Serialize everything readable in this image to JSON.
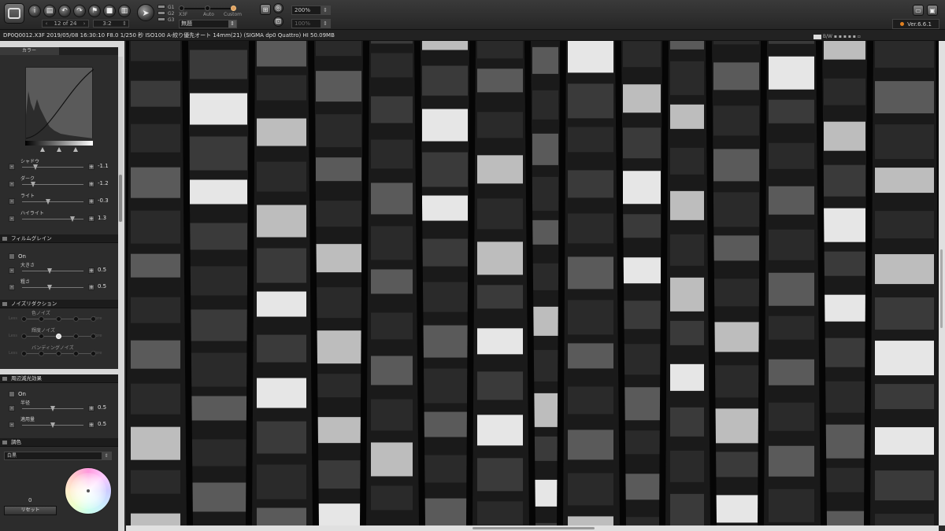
{
  "toolbar": {
    "frame_nav": "12 of 24",
    "aspect": "3:2",
    "mode_select": "無題",
    "track_labels": [
      "X3F",
      "Auto",
      "Custom"
    ],
    "g_labels": [
      "G1",
      "G2",
      "G3"
    ],
    "zoom": "200%",
    "zoom2": "100%",
    "version": "Ver.6.6.1"
  },
  "info": {
    "text": "DP0Q0012.X3F 2019/05/08 16:30:10 F8.0 1/250 秒 ISO100 A-絞り優先オート 14mm(21) (SIGMA dp0 Quattro) HI 50.09MB",
    "bw": "B/W"
  },
  "color_section": {
    "tab": "カラー",
    "sliders": [
      {
        "label": "シャドウ",
        "value": "-1.1",
        "level": 0.22
      },
      {
        "label": "ダーク",
        "value": "-1.2",
        "level": 0.18
      },
      {
        "label": "ライト",
        "value": "-0.3",
        "level": 0.42
      },
      {
        "label": "ハイライト",
        "value": "1.3",
        "level": 0.82
      }
    ]
  },
  "film_grain": {
    "title": "フィルムグレイン",
    "on_label": "On",
    "sliders": [
      {
        "label": "大きさ",
        "value": "0.5",
        "level": 0.45
      },
      {
        "label": "粗さ",
        "value": "0.5",
        "level": 0.45
      }
    ]
  },
  "noise": {
    "title": "ノイズリダクション",
    "rows": [
      {
        "label": "色ノイズ",
        "less": "Less",
        "more": "More",
        "selected": -1
      },
      {
        "label": "輝度ノイズ",
        "less": "Less",
        "more": "More",
        "selected": 2
      },
      {
        "label": "バンディングノイズ",
        "less": "Less",
        "more": "More",
        "selected": -1
      }
    ]
  },
  "vignette": {
    "title": "周辺減光効果",
    "on_label": "On",
    "sliders": [
      {
        "label": "半径",
        "value": "0.5",
        "level": 0.5
      },
      {
        "label": "適用量",
        "value": "0.5",
        "level": 0.5
      }
    ]
  },
  "toning": {
    "title": "調色",
    "select": "白黒",
    "value": "0",
    "reset": "リセット"
  }
}
